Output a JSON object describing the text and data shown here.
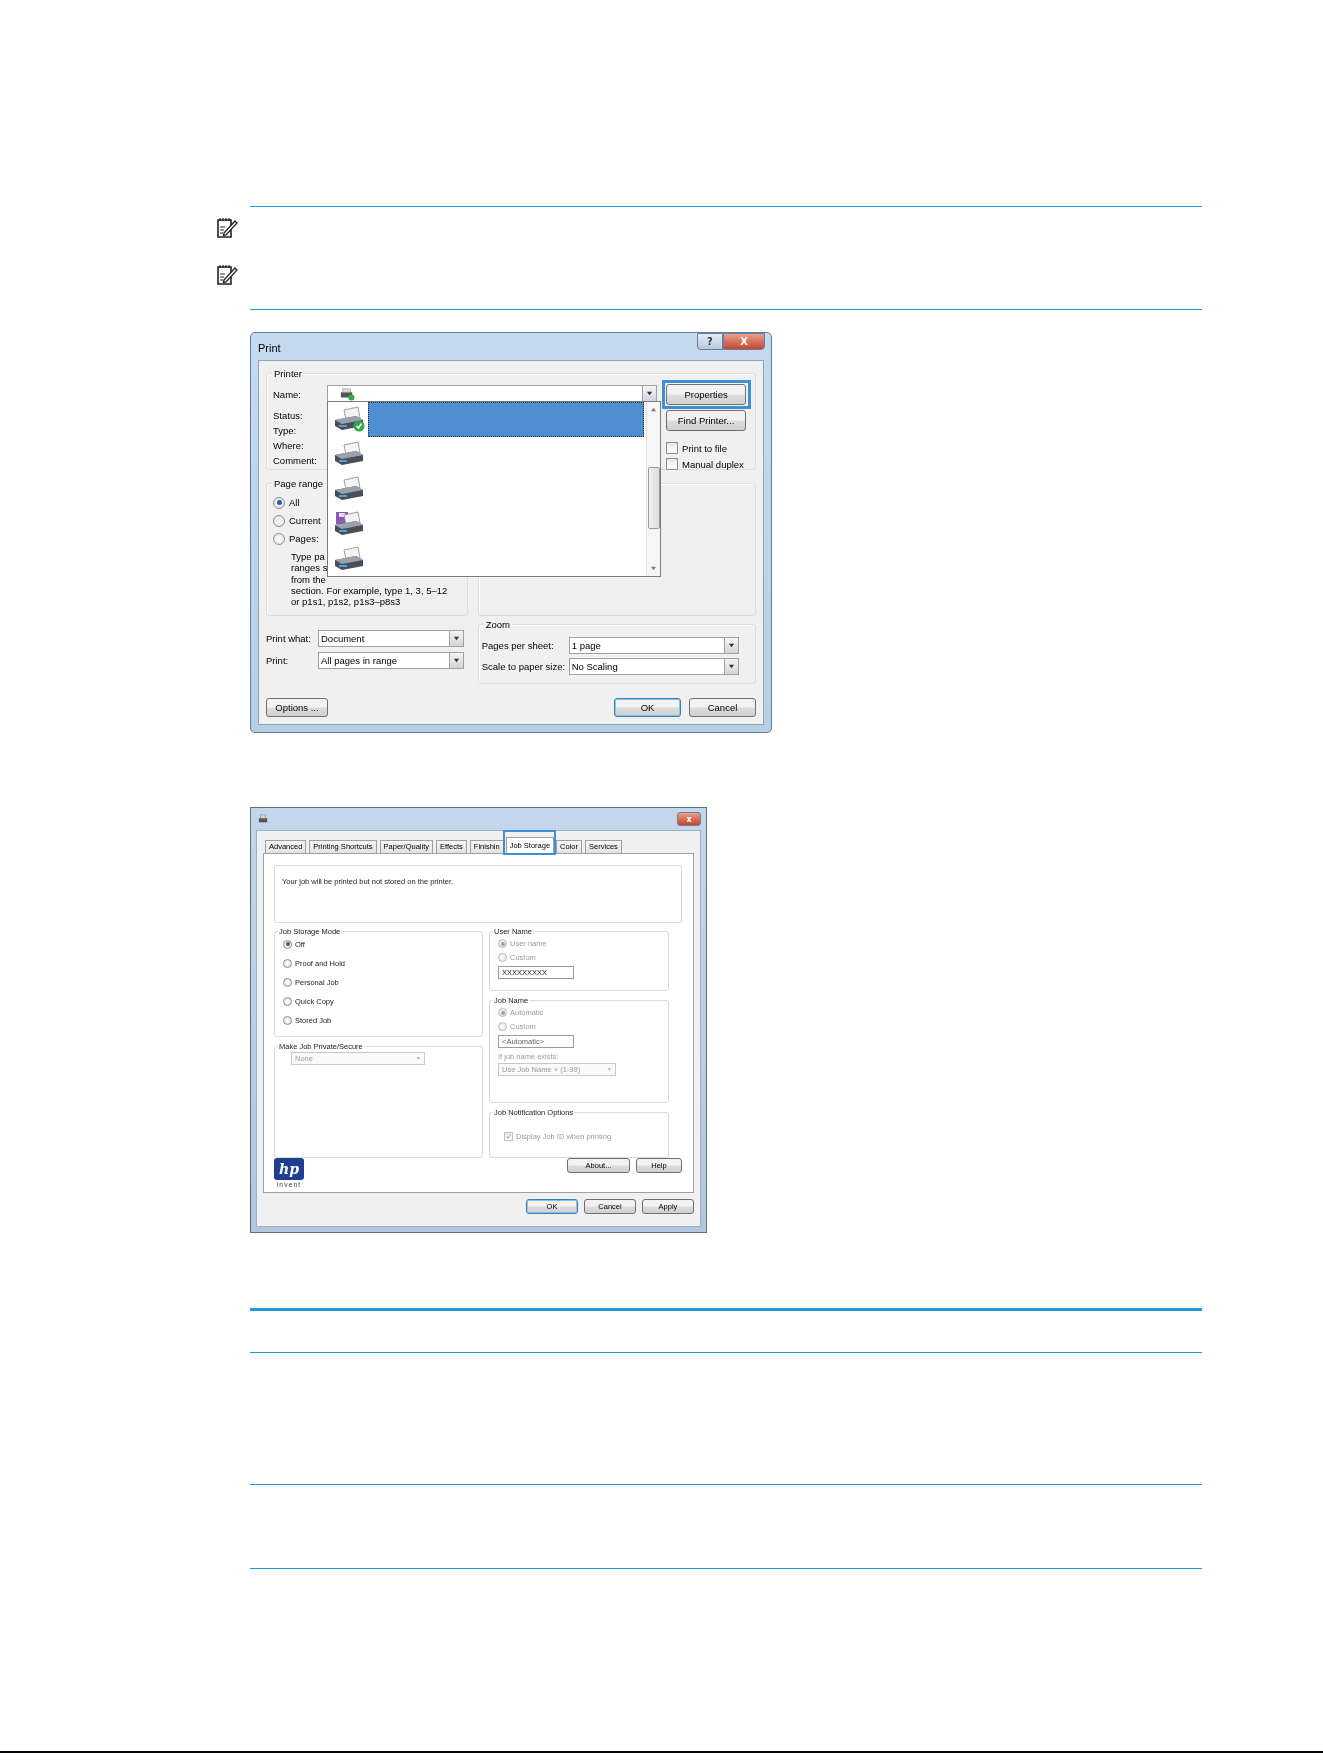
{
  "notes": [
    {
      "kind": "note"
    },
    {
      "kind": "note"
    }
  ],
  "print_dialog": {
    "title": "Print",
    "title_buttons": [
      {
        "kind": "help",
        "glyph": "?"
      },
      {
        "kind": "close",
        "glyph": "X"
      }
    ],
    "printer": {
      "label": "Printer",
      "fields": [
        {
          "label": "Name:"
        },
        {
          "label": "Status:"
        },
        {
          "label": "Type:"
        },
        {
          "label": "Where:"
        },
        {
          "label": "Comment:"
        }
      ],
      "list": [
        {
          "kind": "printer",
          "default": true,
          "selected": true
        },
        {
          "kind": "printer",
          "default": false,
          "selected": false
        },
        {
          "kind": "printer",
          "default": false,
          "selected": false
        },
        {
          "kind": "file",
          "default": false,
          "selected": false
        },
        {
          "kind": "printer",
          "default": false,
          "selected": false
        }
      ],
      "buttons": [
        {
          "label": "Properties",
          "highlighted": true
        },
        {
          "label": "Find Printer...",
          "highlighted": false
        }
      ],
      "checkboxes": [
        {
          "label": "Print to file",
          "checked": false
        },
        {
          "label": "Manual duplex",
          "checked": false
        }
      ]
    },
    "page_range": {
      "label": "Page range",
      "options": [
        {
          "label": "All",
          "selected": true
        },
        {
          "label": "Current",
          "selected": false
        },
        {
          "label": "Pages:",
          "selected": false
        }
      ],
      "hint_lines": [
        "Type pa",
        "ranges s",
        "from the",
        "section. For example, type 1, 3, 5–12",
        "or p1s1, p1s2, p1s3–p8s3"
      ]
    },
    "print_what": {
      "label": "Print what:",
      "value": "Document"
    },
    "print": {
      "label": "Print:",
      "value": "All pages in range"
    },
    "zoom": {
      "label": "Zoom",
      "rows": [
        {
          "label": "Pages per sheet:",
          "value": "1 page"
        },
        {
          "label": "Scale to paper size:",
          "value": "No Scaling"
        }
      ]
    },
    "buttons": [
      {
        "label": "Options ...",
        "kind": "left",
        "default": false
      },
      {
        "label": "OK",
        "kind": "right",
        "default": true
      },
      {
        "label": "Cancel",
        "kind": "right",
        "default": false
      }
    ]
  },
  "properties_dialog": {
    "title_buttons": [
      {
        "kind": "close",
        "glyph": "x"
      }
    ],
    "tabs": [
      {
        "label": "Advanced",
        "selected": false,
        "highlighted": false
      },
      {
        "label": "Printing Shortcuts",
        "selected": false,
        "highlighted": false
      },
      {
        "label": "Paper/Quality",
        "selected": false,
        "highlighted": false
      },
      {
        "label": "Effects",
        "selected": false,
        "highlighted": false
      },
      {
        "label": "Finishin",
        "selected": false,
        "highlighted": false
      },
      {
        "label": "Job Storage",
        "selected": true,
        "highlighted": true
      },
      {
        "label": "Color",
        "selected": false,
        "highlighted": false
      },
      {
        "label": "Services",
        "selected": false,
        "highlighted": false
      }
    ],
    "message": "Your job will be printed but not stored on the printer.",
    "job_storage_mode": {
      "label": "Job Storage Mode",
      "options": [
        {
          "label": "Off",
          "selected": true,
          "disabled": false
        },
        {
          "label": "Proof and Hold",
          "selected": false,
          "disabled": false
        },
        {
          "label": "Personal Job",
          "selected": false,
          "disabled": false
        },
        {
          "label": "Quick Copy",
          "selected": false,
          "disabled": false
        },
        {
          "label": "Stored Job",
          "selected": false,
          "disabled": false
        }
      ]
    },
    "private": {
      "label": "Make Job Private/Secure",
      "value": "None",
      "disabled": true
    },
    "user_name": {
      "label": "User Name",
      "options": [
        {
          "label": "User name",
          "selected": true,
          "disabled": true
        },
        {
          "label": "Custom",
          "selected": false,
          "disabled": true
        }
      ],
      "field": {
        "value": "XXXXXXXXX",
        "disabled": false
      }
    },
    "job_name": {
      "label": "Job Name",
      "options": [
        {
          "label": "Automatic",
          "selected": true,
          "disabled": true
        },
        {
          "label": "Custom",
          "selected": false,
          "disabled": true
        }
      ],
      "field": {
        "value": "<Automatic>",
        "disabled": true
      },
      "exists_label": "If job name exists:",
      "exists_value": "Use Job Name + (1-99)"
    },
    "notification": {
      "label": "Job Notification Options",
      "checkbox": {
        "label": "Display Job ID when printing",
        "checked": true,
        "disabled": true
      }
    },
    "logo": {
      "mark": "hp",
      "tagline": "invent"
    },
    "panel_buttons": [
      {
        "label": "About..."
      },
      {
        "label": "Help"
      }
    ],
    "buttons": [
      {
        "label": "OK",
        "default": true
      },
      {
        "label": "Cancel",
        "default": false
      },
      {
        "label": "Apply",
        "default": false
      }
    ]
  }
}
